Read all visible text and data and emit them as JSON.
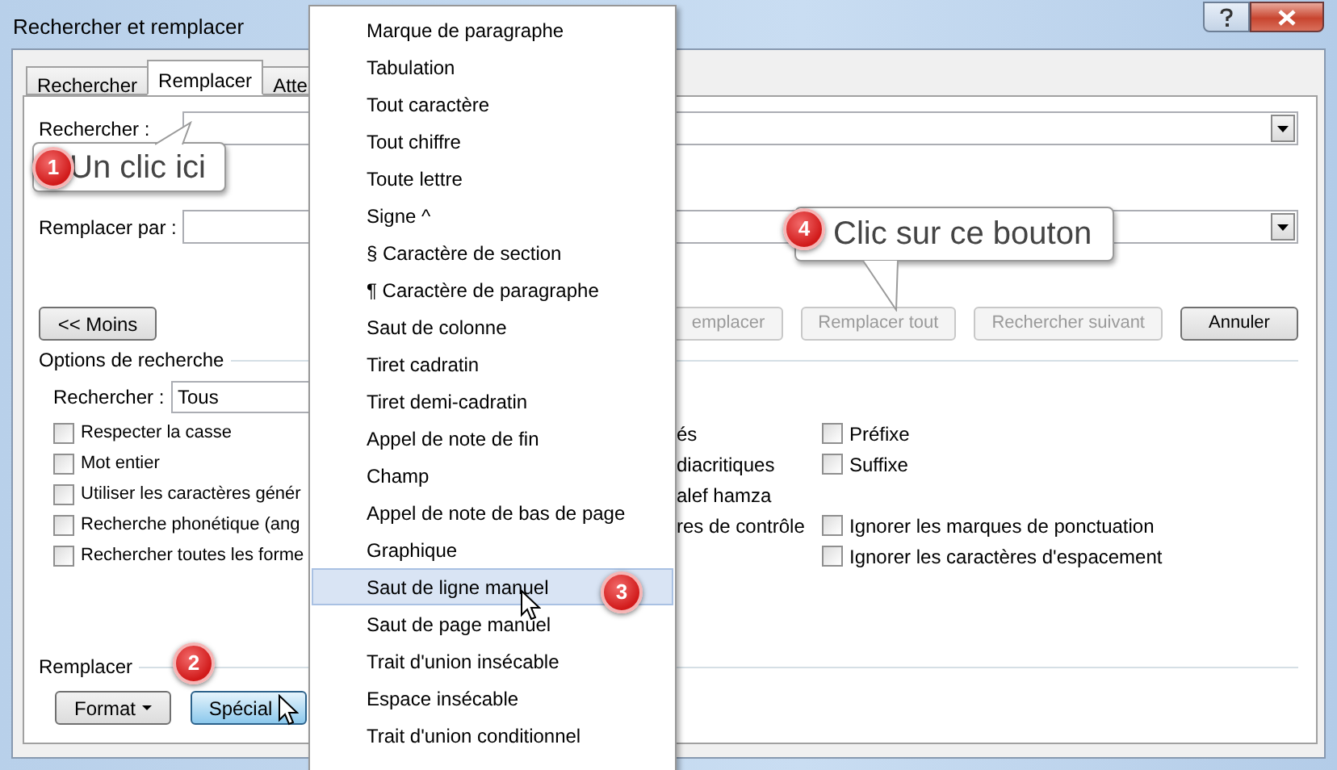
{
  "window": {
    "title": "Rechercher et remplacer"
  },
  "tabs": [
    {
      "label": "Rechercher",
      "selected": false
    },
    {
      "label": "Remplacer",
      "selected": true
    },
    {
      "label": "Atte",
      "selected": false
    }
  ],
  "find": {
    "label": "Rechercher :"
  },
  "replace": {
    "label": "Remplacer par :"
  },
  "less_button": {
    "label": "<< Moins"
  },
  "action_buttons": [
    {
      "label": "emplacer",
      "disabled": true
    },
    {
      "label": "Remplacer tout",
      "disabled": true
    },
    {
      "label": "Rechercher suivant",
      "disabled": true
    },
    {
      "label": "Annuler",
      "disabled": false
    }
  ],
  "options": {
    "title": "Options de recherche",
    "scope_label": "Rechercher :",
    "scope_value": "Tous",
    "left_checks": [
      {
        "label": "Respecter la casse",
        "checked": false
      },
      {
        "label": "Mot entier",
        "checked": false
      },
      {
        "label": "Utiliser les caractères génér",
        "checked": false
      },
      {
        "label": "Recherche phonétique (ang",
        "checked": false
      },
      {
        "label": "Rechercher toutes les forme",
        "checked": false
      }
    ],
    "middle_texts": [
      "és",
      "diacritiques",
      "alef hamza",
      "res de contrôle"
    ],
    "right_checks": [
      {
        "kind": "checkbox",
        "label": "Préfixe",
        "checked": false
      },
      {
        "kind": "checkbox",
        "label": "Suffixe",
        "checked": false
      },
      {
        "kind": "gap"
      },
      {
        "kind": "checkbox",
        "label": "Ignorer les marques de ponctuation",
        "checked": false
      },
      {
        "kind": "checkbox",
        "label": "Ignorer les caractères d'espacement",
        "checked": false
      }
    ]
  },
  "replace_section": {
    "title": "Remplacer",
    "buttons": [
      {
        "label": "Format",
        "selected": false
      },
      {
        "label": "Spécial",
        "selected": true
      }
    ]
  },
  "menu": {
    "items": [
      {
        "label": "Marque de paragraphe",
        "selected": false
      },
      {
        "label": "Tabulation",
        "selected": false
      },
      {
        "label": "Tout caractère",
        "selected": false
      },
      {
        "label": "Tout chiffre",
        "selected": false
      },
      {
        "label": "Toute lettre",
        "selected": false
      },
      {
        "label": "Signe ^",
        "selected": false
      },
      {
        "label": "§ Caractère de section",
        "selected": false
      },
      {
        "label": "¶ Caractère de paragraphe",
        "selected": false
      },
      {
        "label": "Saut de colonne",
        "selected": false
      },
      {
        "label": "Tiret cadratin",
        "selected": false
      },
      {
        "label": "Tiret demi-cadratin",
        "selected": false
      },
      {
        "label": "Appel de note de fin",
        "selected": false
      },
      {
        "label": "Champ",
        "selected": false
      },
      {
        "label": "Appel de note de bas de page",
        "selected": false
      },
      {
        "label": "Graphique",
        "selected": false
      },
      {
        "label": "Saut de ligne manuel",
        "selected": true
      },
      {
        "label": "Saut de page manuel",
        "selected": false
      },
      {
        "label": "Trait d'union insécable",
        "selected": false
      },
      {
        "label": "Espace insécable",
        "selected": false
      },
      {
        "label": "Trait d'union conditionnel",
        "selected": false
      }
    ]
  },
  "callouts": [
    {
      "number": "1",
      "text": "Un clic ici"
    },
    {
      "number": "4",
      "text": "Clic sur ce bouton"
    }
  ],
  "badges": [
    {
      "number": "2"
    },
    {
      "number": "3"
    }
  ]
}
